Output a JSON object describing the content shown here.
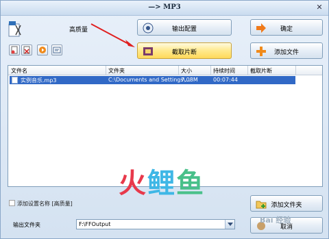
{
  "window": {
    "title": "—> MP3"
  },
  "quality": {
    "label": "高质量"
  },
  "buttons": {
    "output_config": "输出配置",
    "confirm": "确定",
    "clip": "截取片断",
    "add_file": "添加文件",
    "add_folder": "添加文件夹",
    "cancel": "取消"
  },
  "file_list": {
    "columns": [
      "文件名",
      "文件夹",
      "大小",
      "持续时间",
      "截取片断"
    ],
    "rows": [
      {
        "name": "实例音乐.mp3",
        "folder": "C:\\Documents and Settings\\...",
        "size": "7.08M",
        "duration": "00:07:44",
        "clip": ""
      }
    ]
  },
  "watermark": {
    "a": "火",
    "b": "鲤",
    "c": "鱼"
  },
  "add_setting_name": {
    "label": "添加设置名称 [高质量]",
    "checked": false
  },
  "output_folder": {
    "label": "输出文件夹",
    "value": "F:\\FFOutput"
  },
  "overlay": {
    "text": "Bai 经验"
  }
}
